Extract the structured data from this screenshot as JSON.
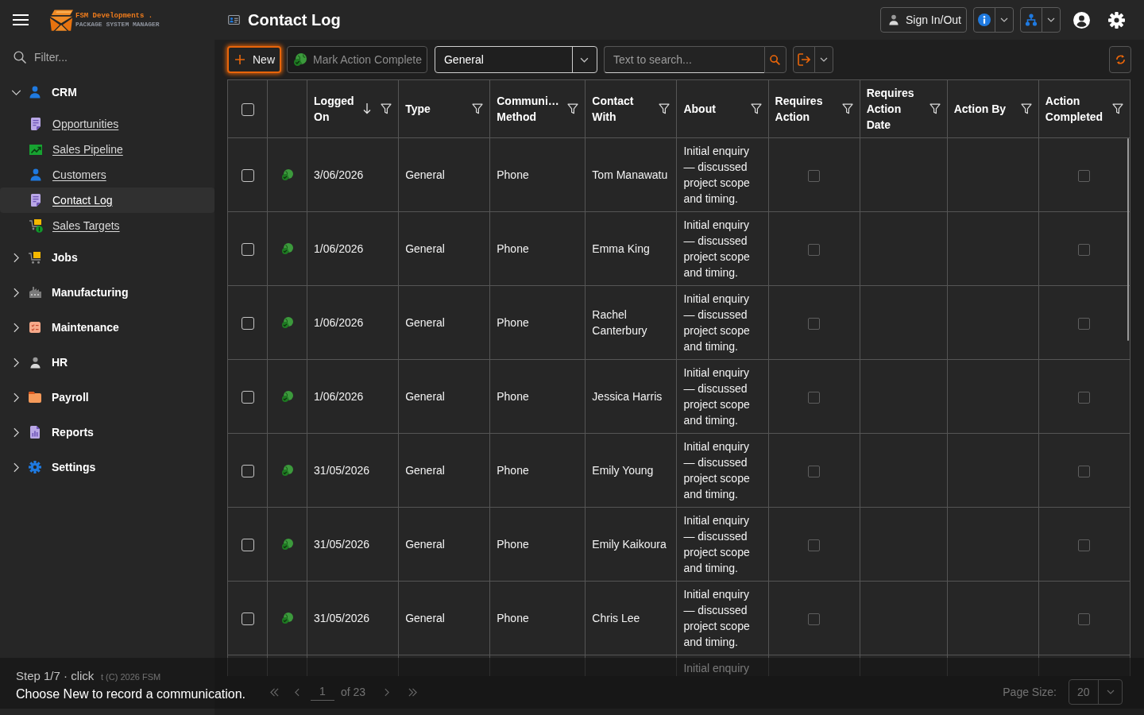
{
  "header": {
    "brand": "FSM Developments .",
    "tagline": "PACKAGE SYSTEM MANAGER",
    "title": "Contact Log",
    "sign_in_button": "Sign In/Out"
  },
  "sidebar": {
    "filter_placeholder": "Filter...",
    "items": [
      {
        "label": "CRM",
        "expanded": true,
        "children": [
          {
            "label": "Opportunities",
            "selected": false
          },
          {
            "label": "Sales Pipeline",
            "selected": false
          },
          {
            "label": "Customers",
            "selected": false
          },
          {
            "label": "Contact Log",
            "selected": true
          },
          {
            "label": "Sales Targets",
            "selected": false
          }
        ]
      },
      {
        "label": "Jobs",
        "expanded": false
      },
      {
        "label": "Manufacturing",
        "expanded": false
      },
      {
        "label": "Maintenance",
        "expanded": false
      },
      {
        "label": "HR",
        "expanded": false
      },
      {
        "label": "Payroll",
        "expanded": false
      },
      {
        "label": "Reports",
        "expanded": false
      },
      {
        "label": "Settings",
        "expanded": false
      }
    ],
    "copyright": "t (C) 2026 FSM"
  },
  "toolbar": {
    "new_button": {
      "label": "New",
      "highlighted": true
    },
    "mark_complete_button": {
      "label": "Mark Action Complete",
      "disabled": true
    },
    "type_select": {
      "value": "General"
    },
    "search": {
      "placeholder": "Text to search..."
    }
  },
  "table": {
    "all_selected": false,
    "columns": [
      {
        "label": "Logged On",
        "sorted": true
      },
      {
        "label": "Type",
        "sorted": false
      },
      {
        "label": "Communi… Method",
        "sorted": false
      },
      {
        "label": "Contact With",
        "sorted": false
      },
      {
        "label": "About",
        "sorted": false
      },
      {
        "label": "Requires Action",
        "sorted": false
      },
      {
        "label": "Requires Action Date",
        "sorted": false
      },
      {
        "label": "Action By",
        "sorted": false
      },
      {
        "label": "Action Completed",
        "sorted": false
      }
    ],
    "rows": [
      {
        "selected": false,
        "logged_on": "3/06/2026",
        "type": "General",
        "method": "Phone",
        "contact_with": "Tom Manawatu",
        "about": "Initial enquiry — discussed project scope and timing.",
        "requires_action": false,
        "action_completed": false
      },
      {
        "selected": false,
        "logged_on": "1/06/2026",
        "type": "General",
        "method": "Phone",
        "contact_with": "Emma King",
        "about": "Initial enquiry — discussed project scope and timing.",
        "requires_action": false,
        "action_completed": false
      },
      {
        "selected": false,
        "logged_on": "1/06/2026",
        "type": "General",
        "method": "Phone",
        "contact_with": "Rachel Canterbury",
        "about": "Initial enquiry — discussed project scope and timing.",
        "requires_action": false,
        "action_completed": false
      },
      {
        "selected": false,
        "logged_on": "1/06/2026",
        "type": "General",
        "method": "Phone",
        "contact_with": "Jessica Harris",
        "about": "Initial enquiry — discussed project scope and timing.",
        "requires_action": false,
        "action_completed": false
      },
      {
        "selected": false,
        "logged_on": "31/05/2026",
        "type": "General",
        "method": "Phone",
        "contact_with": "Emily Young",
        "about": "Initial enquiry — discussed project scope and timing.",
        "requires_action": false,
        "action_completed": false
      },
      {
        "selected": false,
        "logged_on": "31/05/2026",
        "type": "General",
        "method": "Phone",
        "contact_with": "Emily Kaikoura",
        "about": "Initial enquiry — discussed project scope and timing.",
        "requires_action": false,
        "action_completed": false
      },
      {
        "selected": false,
        "logged_on": "31/05/2026",
        "type": "General",
        "method": "Phone",
        "contact_with": "Chris Lee",
        "about": "Initial enquiry — discussed project scope and timing.",
        "requires_action": false,
        "action_completed": false
      },
      {
        "about": "Initial enquiry"
      }
    ]
  },
  "pager": {
    "page": "1",
    "page_count": "of 23",
    "page_size_label": "Page Size:",
    "page_size": "20"
  },
  "tour": {
    "step": "Step 1/7 · click",
    "message": "Choose New to record a communication."
  }
}
